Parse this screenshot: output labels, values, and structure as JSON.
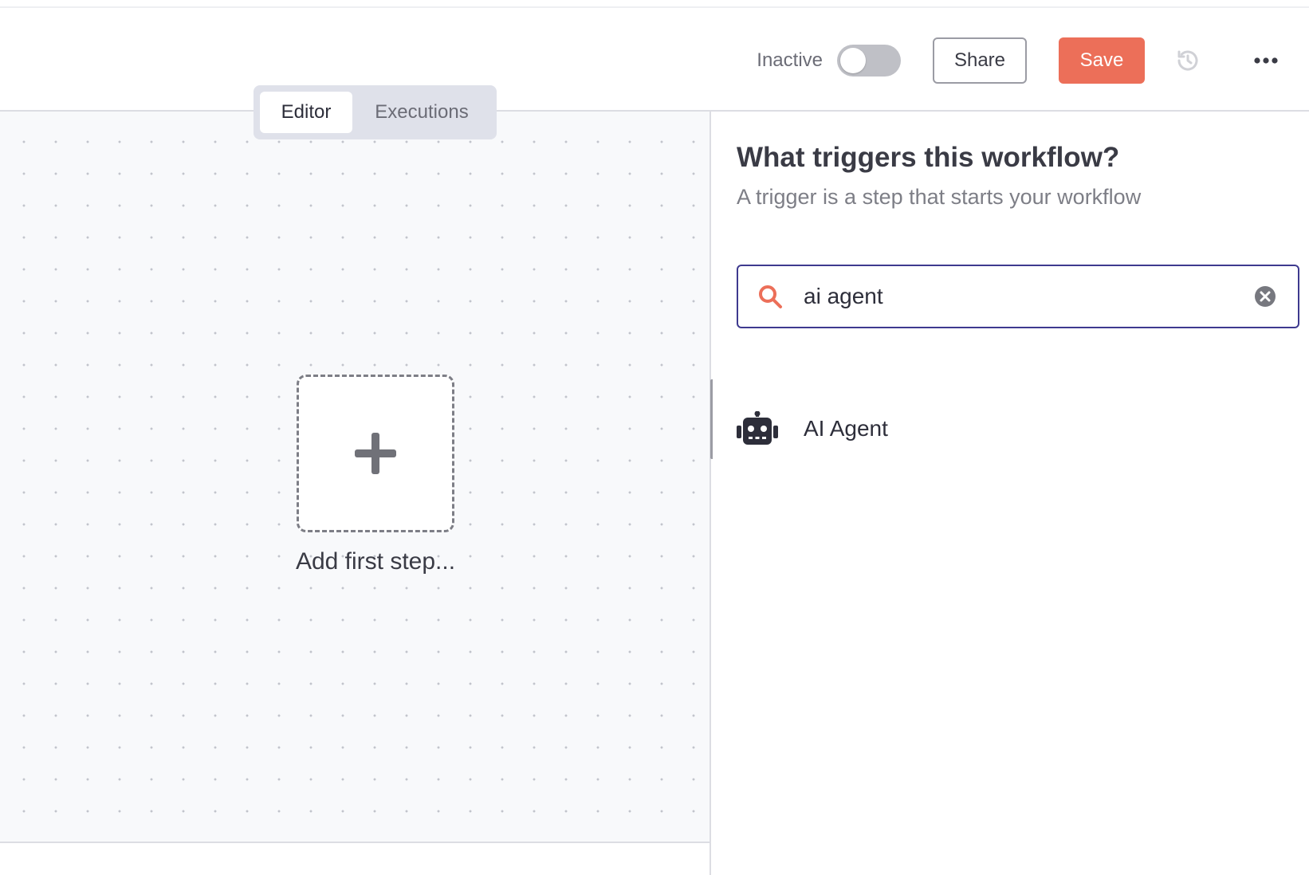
{
  "header": {
    "status_label": "Inactive",
    "share_label": "Share",
    "save_label": "Save"
  },
  "tabs": [
    {
      "label": "Editor",
      "active": true
    },
    {
      "label": "Executions",
      "active": false
    }
  ],
  "canvas": {
    "add_step_label": "Add first step..."
  },
  "panel": {
    "title": "What triggers this workflow?",
    "subtitle": "A trigger is a step that starts your workflow",
    "search": {
      "value": "ai agent",
      "placeholder": ""
    },
    "results": [
      {
        "label": "AI Agent",
        "icon": "robot-icon"
      }
    ]
  },
  "colors": {
    "accent": "#ec6f59",
    "search_border": "#3e3a8f"
  },
  "icons": [
    "history-icon",
    "more-icon",
    "search-icon",
    "clear-icon",
    "plus-icon",
    "robot-icon"
  ]
}
